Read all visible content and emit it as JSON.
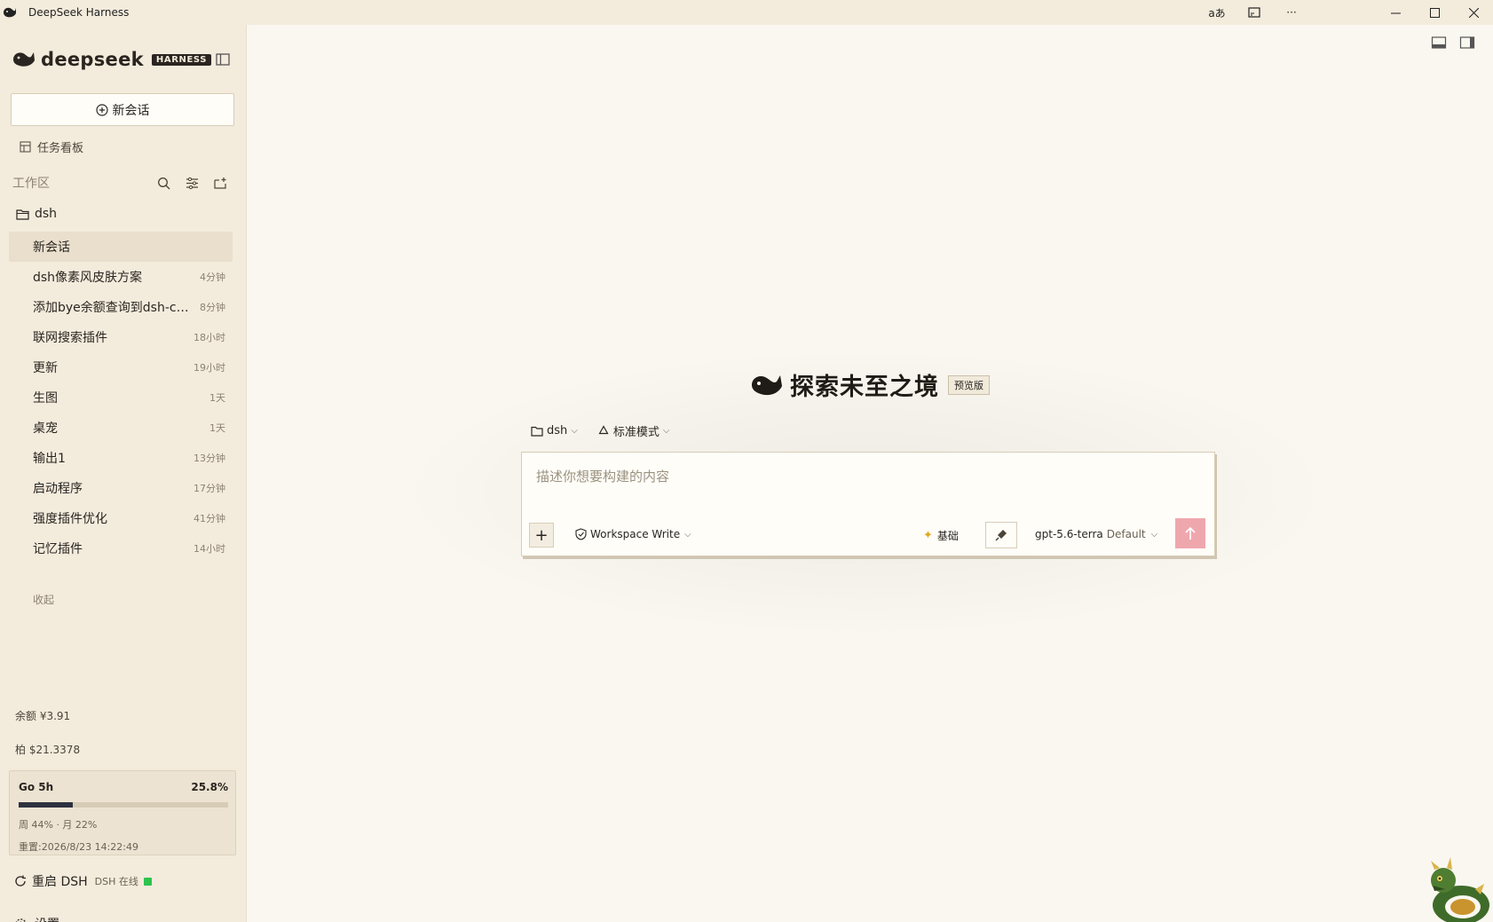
{
  "window": {
    "title": "DeepSeek Harness",
    "controls": [
      "minimize",
      "maximize",
      "close"
    ]
  },
  "sidebar": {
    "brand": {
      "name": "deepseek",
      "badge": "HARNESS"
    },
    "new_chat_label": "新会话",
    "taskboard_label": "任务看板",
    "workspace_label": "工作区",
    "folder_name": "dsh",
    "sessions": [
      {
        "title": "新会话",
        "time": "",
        "active": true
      },
      {
        "title": "dsh像素风皮肤方案",
        "time": "4分钟",
        "active": false
      },
      {
        "title": "添加bye余额查询到dsh-co…",
        "time": "8分钟",
        "active": false
      },
      {
        "title": "联网搜索插件",
        "time": "18小时",
        "active": false
      },
      {
        "title": "更新",
        "time": "19小时",
        "active": false
      },
      {
        "title": "生图",
        "time": "1天",
        "active": false
      },
      {
        "title": "桌宠",
        "time": "1天",
        "active": false
      },
      {
        "title": "输出1",
        "time": "13分钟",
        "active": false
      },
      {
        "title": "启动程序",
        "time": "17分钟",
        "active": false
      },
      {
        "title": "强度插件优化",
        "time": "41分钟",
        "active": false
      },
      {
        "title": "记忆插件",
        "time": "14小时",
        "active": false
      }
    ],
    "collapse_label": "收起",
    "balance": "余额 ¥3.91",
    "balance2": "柏 $21.3378",
    "usage": {
      "label": "Go 5h",
      "percent_text": "25.8%",
      "percent": 25.8,
      "detail": "周 44% · 月 22%",
      "reset": "重置:2026/8/23 14:22:49"
    },
    "restart_label": "重启 DSH",
    "status_text": "DSH 在线",
    "status_color": "#2ec24f",
    "settings_label": "设置"
  },
  "main": {
    "hero_title": "探索未至之境",
    "preview_badge": "预览版",
    "context": {
      "folder": "dsh",
      "mode": "标准模式"
    },
    "composer": {
      "placeholder": "描述你想要构建的内容",
      "permission": "Workspace Write",
      "base_label": "基础",
      "model": "gpt-5.6-terra",
      "model_mode": "Default"
    }
  },
  "colors": {
    "sidebar_bg": "#f3ebdc",
    "main_bg": "#faf7f0",
    "send_button": "#efa7ae",
    "usage_bar": "#2e3240"
  },
  "icons": [
    "app-whale-icon",
    "translate-icon",
    "cast-icon",
    "more-icon",
    "sidebar-toggle-icon",
    "plus-circle-icon",
    "board-icon",
    "search-icon",
    "filter-icon",
    "new-folder-icon",
    "folder-icon",
    "refresh-icon",
    "gear-icon",
    "shield-icon",
    "sparkle-icon",
    "mic-icon",
    "arrow-up-icon",
    "dragon-mascot-icon"
  ]
}
